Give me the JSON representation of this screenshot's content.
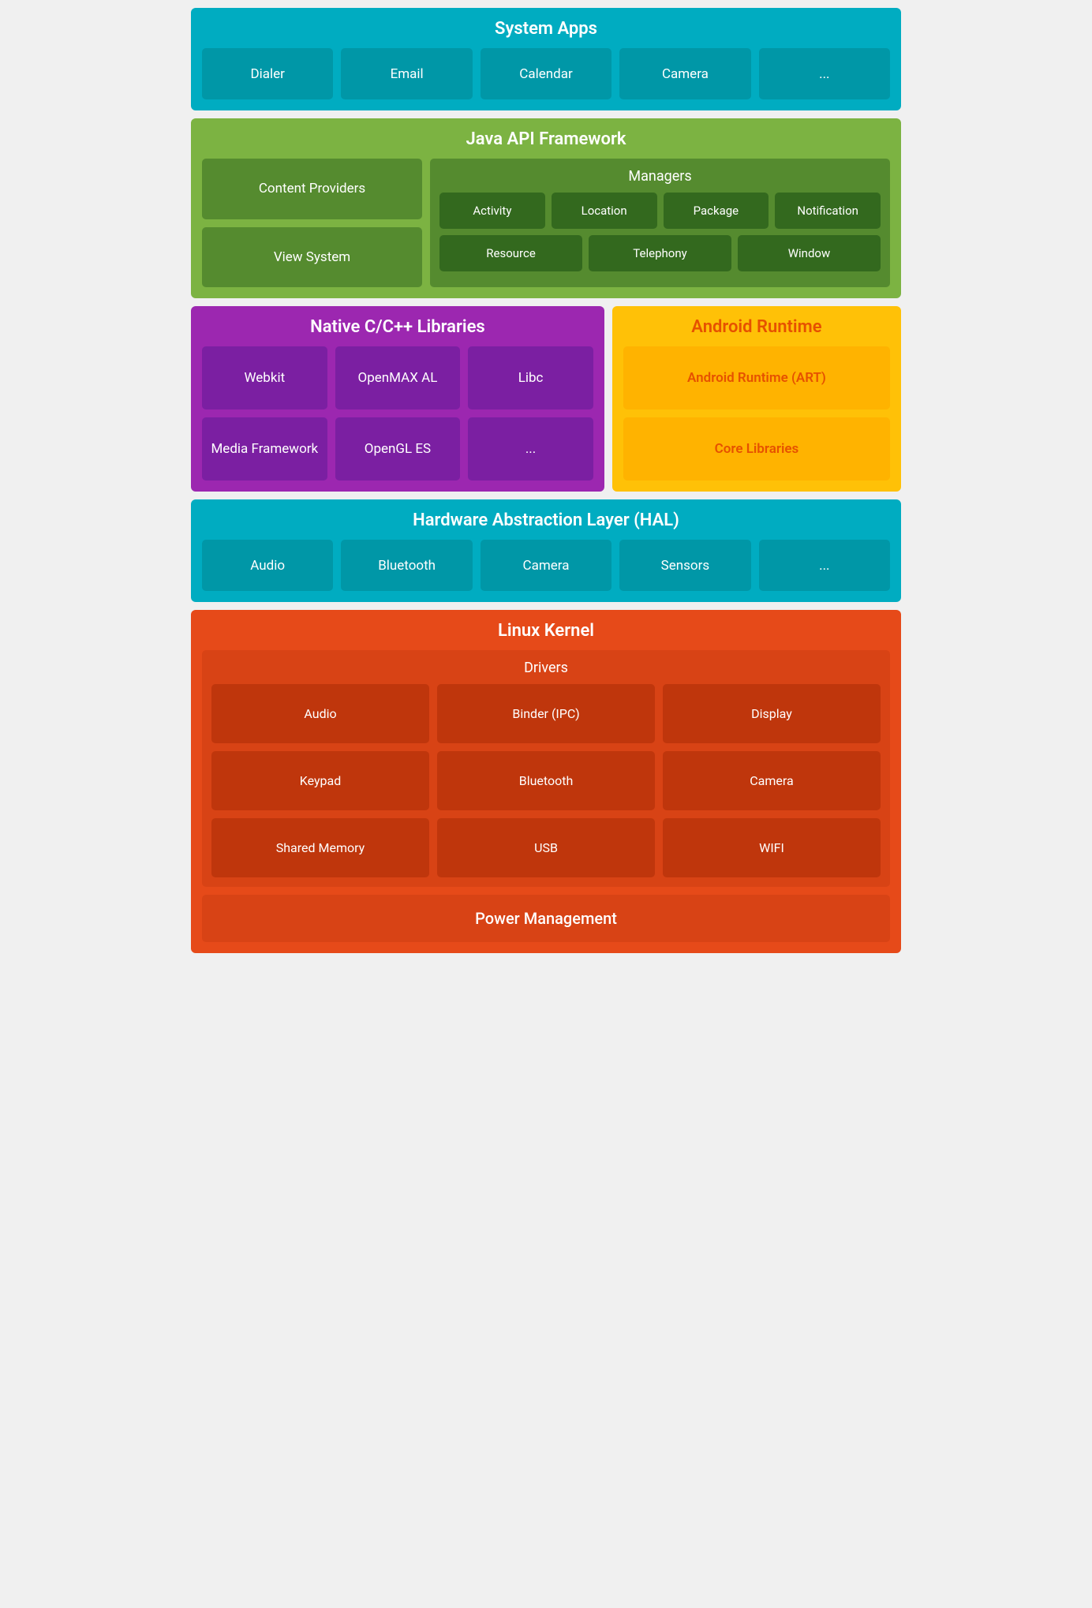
{
  "systemApps": {
    "title": "System Apps",
    "tiles": [
      "Dialer",
      "Email",
      "Calendar",
      "Camera",
      "..."
    ]
  },
  "javaApi": {
    "title": "Java API Framework",
    "leftTiles": [
      "Content Providers",
      "View System"
    ],
    "managers": {
      "title": "Managers",
      "row1": [
        "Activity",
        "Location",
        "Package",
        "Notification"
      ],
      "row2": [
        "Resource",
        "Telephony",
        "Window"
      ]
    }
  },
  "nativeCpp": {
    "title": "Native C/C++ Libraries",
    "tiles": [
      "Webkit",
      "OpenMAX AL",
      "Libc",
      "Media Framework",
      "OpenGL ES",
      "..."
    ]
  },
  "androidRuntime": {
    "title": "Android Runtime",
    "tiles": [
      "Android Runtime (ART)",
      "Core Libraries"
    ]
  },
  "hal": {
    "title": "Hardware Abstraction Layer (HAL)",
    "tiles": [
      "Audio",
      "Bluetooth",
      "Camera",
      "Sensors",
      "..."
    ]
  },
  "linuxKernel": {
    "title": "Linux Kernel",
    "drivers": {
      "title": "Drivers",
      "tiles": [
        "Audio",
        "Binder (IPC)",
        "Display",
        "Keypad",
        "Bluetooth",
        "Camera",
        "Shared Memory",
        "USB",
        "WIFI"
      ]
    },
    "powerManagement": "Power Management"
  }
}
